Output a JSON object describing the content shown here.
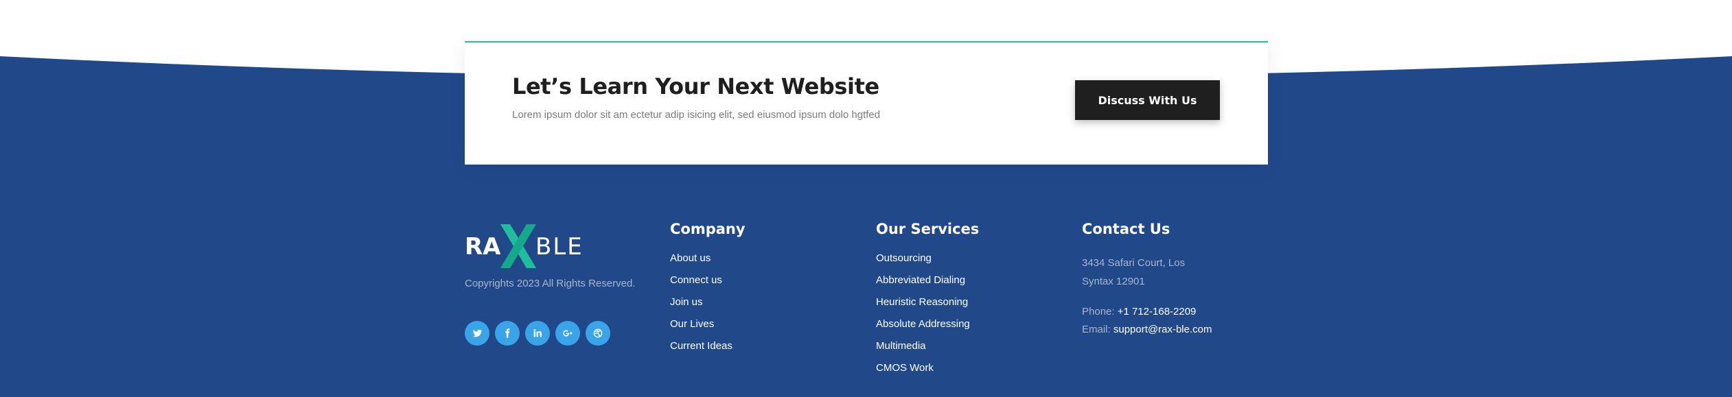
{
  "cta": {
    "title": "Let’s Learn Your Next Website",
    "subtitle": "Lorem ipsum dolor sit am ectetur adip isicing elit, sed eiusmod ipsum dolo hgtfed",
    "button_label": "Discuss With Us"
  },
  "brand": {
    "logo_left": "RA",
    "logo_right": "BLE",
    "copyright": "Copyrights 2023 All Rights Reserved."
  },
  "socials": [
    "twitter-icon",
    "facebook-icon",
    "linkedin-icon",
    "google-plus-icon",
    "dribbble-icon"
  ],
  "company": {
    "heading": "Company",
    "links": [
      "About us",
      "Connect us",
      "Join us",
      "Our Lives",
      "Current Ideas"
    ]
  },
  "services": {
    "heading": "Our Services",
    "links": [
      "Outsourcing",
      "Abbreviated Dialing",
      "Heuristic Reasoning",
      "Absolute Addressing",
      "Multimedia",
      "CMOS Work"
    ]
  },
  "contact": {
    "heading": "Contact Us",
    "address_line1": "3434 Safari Court, Los",
    "address_line2": "Syntax 12901",
    "phone_label": "Phone:",
    "phone_value": "+1 712-168-2209",
    "email_label": "Email:",
    "email_value": "support@rax-ble.com"
  },
  "colors": {
    "footer_bg": "#21498a",
    "accent": "#1fbf9e",
    "social_bg": "#3aa4e8",
    "button_bg": "#1f1f1f"
  }
}
